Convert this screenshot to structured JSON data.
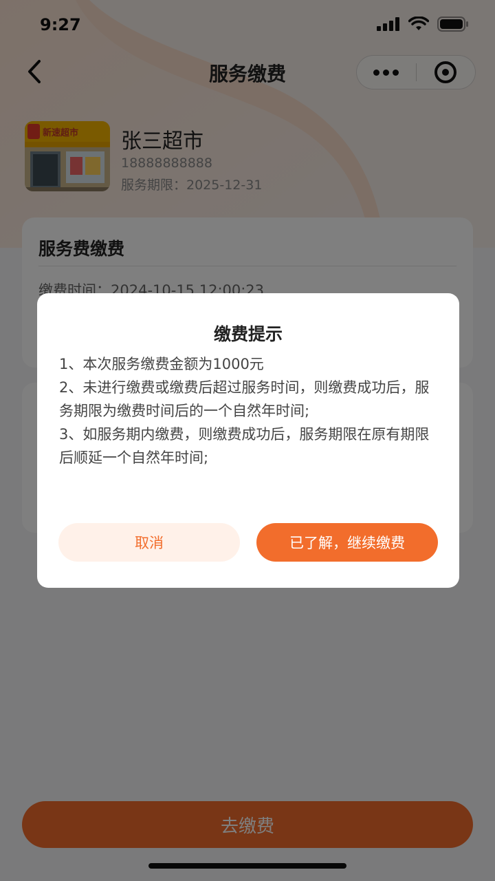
{
  "status_bar": {
    "time": "9:27",
    "icons": [
      "signal-icon",
      "wifi-icon",
      "battery-icon"
    ]
  },
  "nav": {
    "title": "服务缴费",
    "back_icon": "chevron-left-icon",
    "capsule_icons": [
      "more-dots-icon",
      "target-icon"
    ]
  },
  "shop": {
    "name": "张三超市",
    "phone": "18888888888",
    "expiry": "服务期限：2025-12-31",
    "logo_text": "新速超市"
  },
  "card": {
    "title": "服务费缴费",
    "pay_time": "缴费时间：2024-10-15 12:00:23"
  },
  "pay_button": "去缴费",
  "dialog": {
    "title": "缴费提示",
    "lines": [
      "1、本次服务缴费金额为1000元",
      "2、未进行缴费或缴费后超过服务时间，则缴费成功后，服务期限为缴费时间后的一个自然年时间;",
      "3、如服务期内缴费，则缴费成功后，服务期限在原有期限后顺延一个自然年时间;"
    ],
    "cancel_label": "取消",
    "confirm_label": "已了解，继续缴费"
  },
  "colors": {
    "accent": "#f26d2c",
    "accent_light": "#fff1e9",
    "overlay": "rgba(0,0,0,0.5)"
  }
}
